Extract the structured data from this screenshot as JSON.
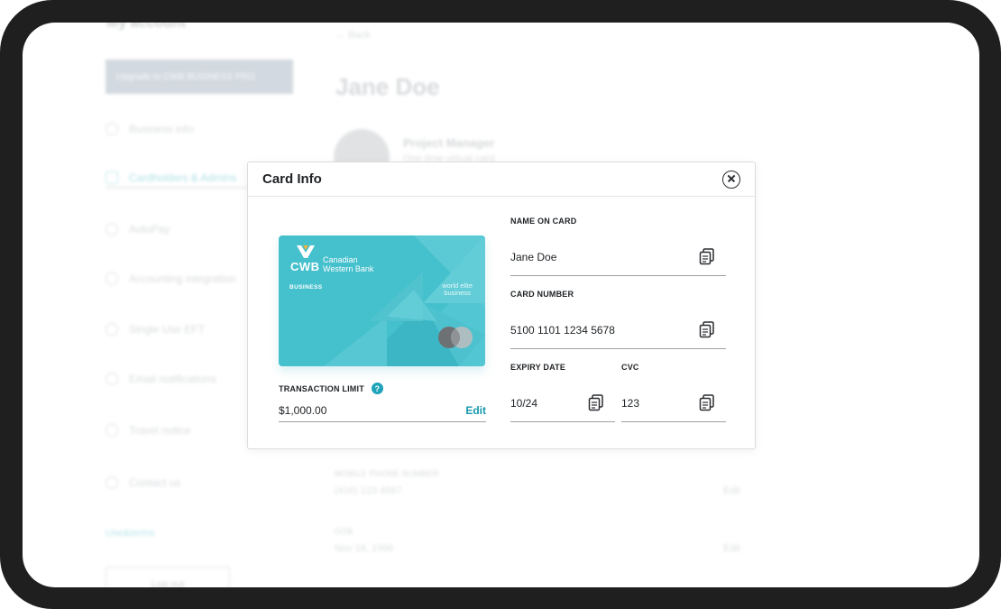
{
  "background": {
    "account_title": "My account",
    "upgrade_label": "Upgrade to CWB BUSINESS PRO",
    "menu": [
      {
        "label": "Business info"
      },
      {
        "label": "Cardholders & Admins"
      },
      {
        "label": "AutoPay"
      },
      {
        "label": "Accounting integration"
      },
      {
        "label": "Single Use EFT"
      },
      {
        "label": "Email notifications"
      },
      {
        "label": "Travel notice"
      },
      {
        "label": "Contact us"
      }
    ],
    "terms_label": "Use&terms",
    "logout_label": "Log out",
    "back_label": "Back",
    "user_name": "Jane Doe",
    "user_role": "Project Manager",
    "user_role_sub": "One time virtual card",
    "mobile_label": "MOBILE PHONE NUMBER",
    "mobile_value": "(416) 123 4567",
    "dob_label": "DOB",
    "dob_value": "Nov 18, 1996",
    "edit_label": "Edit"
  },
  "modal": {
    "title": "Card Info",
    "card": {
      "bank_abbr": "CWB",
      "bank_name": "Canadian Western Bank",
      "card_type": "BUSINESS",
      "tier_line1": "world elite",
      "tier_line2": "business"
    },
    "transaction_limit_label": "TRANSACTION LIMIT",
    "transaction_limit_value": "$1,000.00",
    "transaction_limit_edit": "Edit",
    "fields": {
      "name_label": "NAME ON CARD",
      "name_value": "Jane Doe",
      "number_label": "CARD NUMBER",
      "number_value": "5100 1101 1234 5678",
      "expiry_label": "EXPIRY DATE",
      "expiry_value": "10/24",
      "cvc_label": "CVC",
      "cvc_value": "123"
    }
  },
  "colors": {
    "card": "#45c0cd",
    "accent": "#1798ad",
    "frame": "#1f1f1f"
  }
}
